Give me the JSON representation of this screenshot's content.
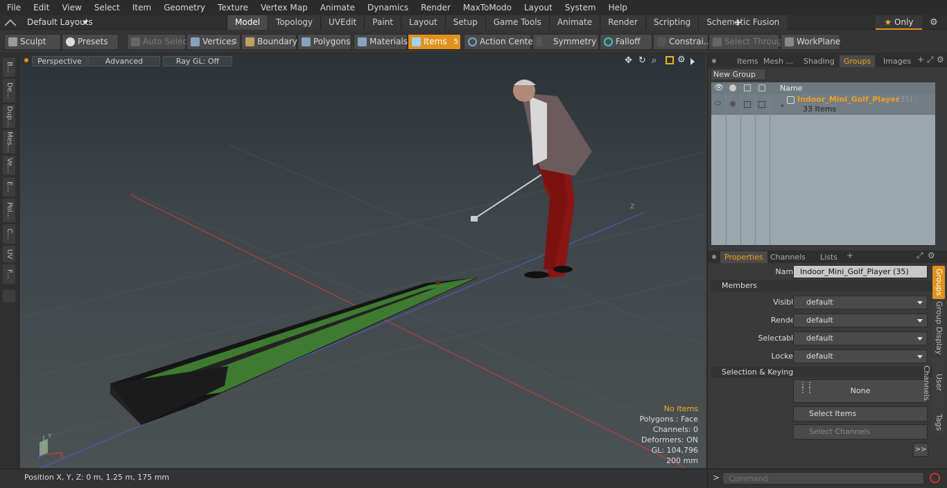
{
  "menu": [
    "File",
    "Edit",
    "View",
    "Select",
    "Item",
    "Geometry",
    "Texture",
    "Vertex Map",
    "Animate",
    "Dynamics",
    "Render",
    "MaxToModo",
    "Layout",
    "System",
    "Help"
  ],
  "layouts": {
    "label": "Default Layouts"
  },
  "mode_tabs": [
    "Model",
    "Topology",
    "UVEdit",
    "Paint",
    "Layout",
    "Setup",
    "Game Tools",
    "Animate",
    "Render",
    "Scripting",
    "Schematic Fusion"
  ],
  "only_label": "Only",
  "toolbar": {
    "sculpt": "Sculpt",
    "presets": "Presets",
    "auto_select": "Auto Select",
    "vertices": "Vertices",
    "vertices_count": "1",
    "boundary": "Boundary",
    "polygons": "Polygons",
    "materials": "Materials",
    "items": "Items",
    "items_count": "5",
    "action_center": "Action Center",
    "symmetry": "Symmetry",
    "falloff": "Falloff",
    "constraints": "Constrai...",
    "select_through": "Select Through",
    "workplane": "WorkPlane"
  },
  "left_tabs": [
    "B...",
    "De...",
    "Dup...",
    "Mes...",
    "Ve...",
    "E...",
    "Pol...",
    "C...",
    "UV",
    "F..."
  ],
  "viewport": {
    "perspective": "Perspective",
    "advanced": "Advanced",
    "raygl": "Ray GL: Off"
  },
  "stats": {
    "no_items": "No Items",
    "polygons": "Polygons : Face",
    "channels": "Channels: 0",
    "deformers": "Deformers: ON",
    "gl": "GL: 104,796",
    "scale": "200 mm"
  },
  "axis_labels": {
    "y": "Y",
    "x": "X",
    "z": "Z"
  },
  "status": {
    "position": "Position X, Y, Z:   0 m, 1.25 m, 175 mm"
  },
  "top_panel_tabs": [
    "Items",
    "Mesh ...",
    "Shading",
    "Groups",
    "Images"
  ],
  "new_group": "New Group",
  "group_table": {
    "name_col": "Name",
    "group_name": "Indoor_Mini_Golf_Player",
    "group_count": "(35) :",
    "group_items": "33 Items"
  },
  "props_tabs": [
    "Properties",
    "Channels",
    "Lists"
  ],
  "properties": {
    "name_label": "Name",
    "name_value": "Indoor_Mini_Golf_Player (35)",
    "members": "Members",
    "visible_label": "Visible",
    "visible": "default",
    "render_label": "Render",
    "render": "default",
    "selectable_label": "Selectable",
    "selectable": "default",
    "locked_label": "Locked",
    "locked": "default",
    "sel_keying": "Selection & Keying",
    "none": "None",
    "select_items": "Select Items",
    "select_channels": "Select Channels",
    "more": ">>"
  },
  "side_tabs": [
    "Groups",
    "Group Display",
    "User Channels",
    "Tags"
  ],
  "command": {
    "prompt": ">",
    "placeholder": "Command"
  },
  "colors": {
    "accent": "#e0921f",
    "panel": "#3a3a3a",
    "table": "#9aa7ae"
  }
}
